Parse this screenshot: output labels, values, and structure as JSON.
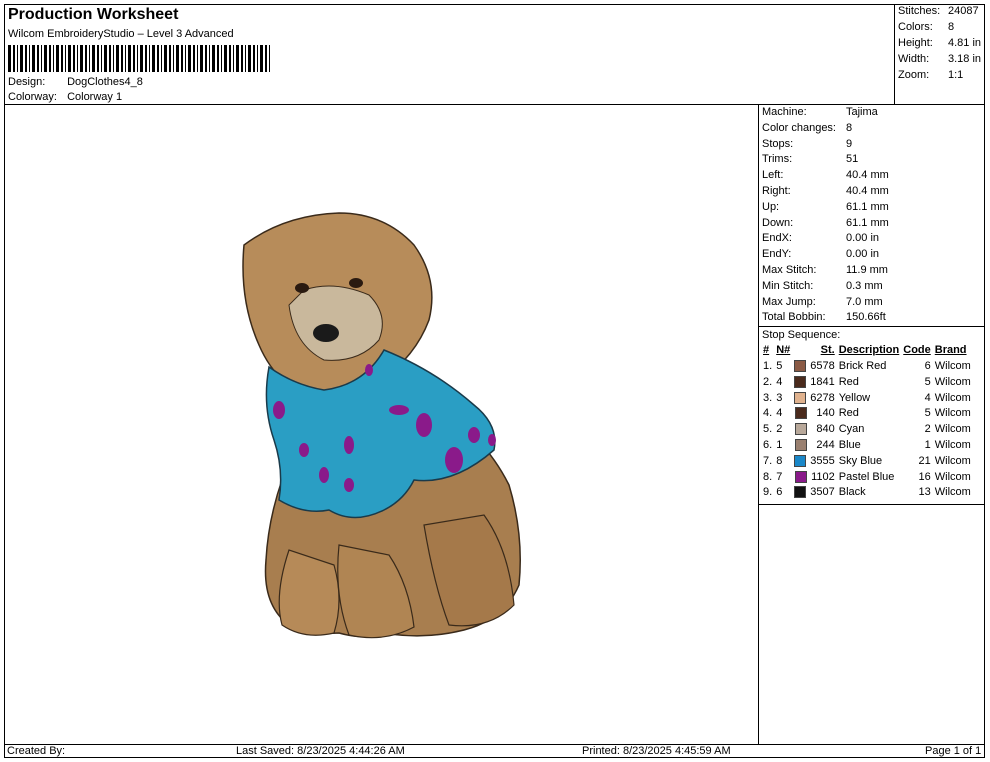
{
  "header": {
    "title": "Production Worksheet",
    "subtitle": "Wilcom EmbroideryStudio – Level 3 Advanced",
    "design_label": "Design:",
    "design_value": "DogClothes4_8",
    "colorway_label": "Colorway:",
    "colorway_value": "Colorway 1"
  },
  "stats": [
    {
      "label": "Stitches:",
      "value": "24087"
    },
    {
      "label": "Colors:",
      "value": "8"
    },
    {
      "label": "Height:",
      "value": "4.81 in"
    },
    {
      "label": "Width:",
      "value": "3.18 in"
    },
    {
      "label": "Zoom:",
      "value": "1:1"
    }
  ],
  "machine_info": [
    {
      "label": "Machine:",
      "value": "Tajima"
    },
    {
      "label": "Color changes:",
      "value": "8"
    },
    {
      "label": "Stops:",
      "value": "9"
    },
    {
      "label": "Trims:",
      "value": "51"
    },
    {
      "label": "Left:",
      "value": "40.4 mm"
    },
    {
      "label": "Right:",
      "value": "40.4 mm"
    },
    {
      "label": "Up:",
      "value": "61.1 mm"
    },
    {
      "label": "Down:",
      "value": "61.1 mm"
    },
    {
      "label": "EndX:",
      "value": "0.00 in"
    },
    {
      "label": "EndY:",
      "value": "0.00 in"
    },
    {
      "label": "Max Stitch:",
      "value": "11.9 mm"
    },
    {
      "label": "Min Stitch:",
      "value": "0.3 mm"
    },
    {
      "label": "Max Jump:",
      "value": "7.0 mm"
    },
    {
      "label": "Total Bobbin:",
      "value": "150.66ft"
    }
  ],
  "stop_sequence": {
    "label": "Stop Sequence:",
    "headers": [
      "#",
      "N#",
      "St.",
      "Description",
      "Code",
      "Brand"
    ],
    "rows": [
      {
        "idx": "1.",
        "n": "5",
        "color": "#8a5a45",
        "st": "6578",
        "desc": "Brick Red",
        "code": "6",
        "brand": "Wilcom"
      },
      {
        "idx": "2.",
        "n": "4",
        "color": "#4a2a1c",
        "st": "1841",
        "desc": "Red",
        "code": "5",
        "brand": "Wilcom"
      },
      {
        "idx": "3.",
        "n": "3",
        "color": "#e0b28e",
        "st": "6278",
        "desc": "Yellow",
        "code": "4",
        "brand": "Wilcom"
      },
      {
        "idx": "4.",
        "n": "4",
        "color": "#4a2a1c",
        "st": "140",
        "desc": "Red",
        "code": "5",
        "brand": "Wilcom"
      },
      {
        "idx": "5.",
        "n": "2",
        "color": "#b8a89a",
        "st": "840",
        "desc": "Cyan",
        "code": "2",
        "brand": "Wilcom"
      },
      {
        "idx": "6.",
        "n": "1",
        "color": "#9a8070",
        "st": "244",
        "desc": "Blue",
        "code": "1",
        "brand": "Wilcom"
      },
      {
        "idx": "7.",
        "n": "8",
        "color": "#1a87c8",
        "st": "3555",
        "desc": "Sky Blue",
        "code": "21",
        "brand": "Wilcom"
      },
      {
        "idx": "8.",
        "n": "7",
        "color": "#8a1a8a",
        "st": "1102",
        "desc": "Pastel Blue",
        "code": "16",
        "brand": "Wilcom"
      },
      {
        "idx": "9.",
        "n": "6",
        "color": "#111111",
        "st": "3507",
        "desc": "Black",
        "code": "13",
        "brand": "Wilcom"
      }
    ]
  },
  "footer": {
    "created_by": "Created By:",
    "last_saved": "Last Saved: 8/23/2025 4:44:26 AM",
    "printed": "Printed: 8/23/2025 4:45:59 AM",
    "page": "Page 1 of 1"
  }
}
